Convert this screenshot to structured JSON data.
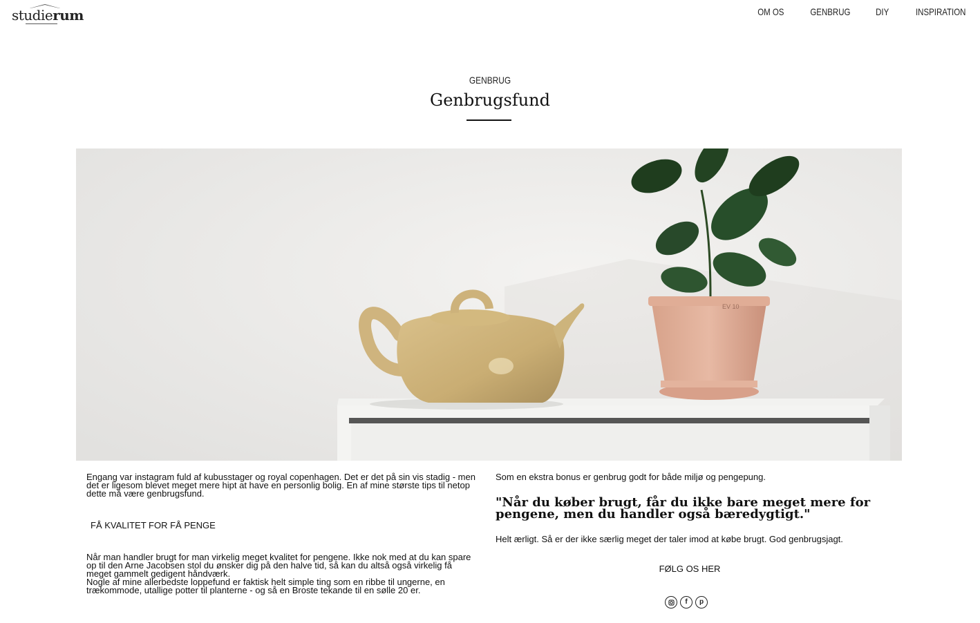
{
  "brand": {
    "part1": "studie",
    "part2": "rum"
  },
  "nav": {
    "items": [
      "OM OS",
      "GENBRUG",
      "DIY",
      "INSPIRATION"
    ]
  },
  "post": {
    "category": "GENBRUG",
    "title": "Genbrugsfund",
    "hero_image": "teapot-and-plant-on-white-shelf"
  },
  "left": {
    "intro": "Engang var instagram fuld af kubusstager og royal copenhagen. Det er det på sin vis stadig - men det er ligesom blevet meget mere hipt at have en personlig bolig. En af mine største tips til netop dette må være genbrugsfund.",
    "heading": "FÅ KVALITET FOR FÅ PENGE",
    "body1": "Når man handler brugt for man virkelig meget kvalitet for pengene. Ikke nok med at du kan spare op til den Arne Jacobsen stol du ønsker dig på den halve tid, så kan du altså også virkelig få meget gammelt gedigent håndværk.",
    "body2": "Nogle af mine allerbedste loppefund er faktisk helt simple ting som en ribbe til ungerne, en trækommode, utallige potter til planterne - og så en Broste tekande til en sølle 20 er."
  },
  "right": {
    "intro": "Som en ekstra bonus er genbrug godt for både miljø og pengepung.",
    "quote": "\"Når du køber brugt, får du ikke bare meget mere for pengene, men du handler også bæredygtigt.\"",
    "outro": "Helt ærligt. Så er der ikke særlig meget der taler imod at købe brugt. God genbrugsjagt.",
    "follow_label": "FØLG OS HER",
    "socials": [
      "instagram-icon",
      "facebook-icon",
      "pinterest-icon"
    ]
  }
}
